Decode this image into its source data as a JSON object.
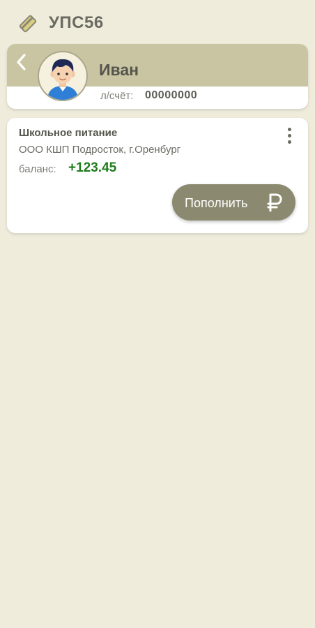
{
  "app": {
    "title": "УПС56",
    "logo_icon": "card-icon"
  },
  "profile": {
    "name": "Иван",
    "account_label": "л/счёт:",
    "account_number": "00000000",
    "back_icon": "chevron-left-icon",
    "avatar_icon": "boy-avatar-icon"
  },
  "service": {
    "title": "Школьное питание",
    "provider": "ООО КШП Подросток, г.Оренбург",
    "balance_label": "баланс:",
    "balance_value": "+123.45",
    "topup_label": "Пополнить",
    "topup_icon": "ruble-icon",
    "more_icon": "more-vert-icon"
  },
  "colors": {
    "background": "#efecdc",
    "header_band": "#c9c5a3",
    "button": "#8b8a70",
    "balance_positive": "#1e7d1c"
  }
}
